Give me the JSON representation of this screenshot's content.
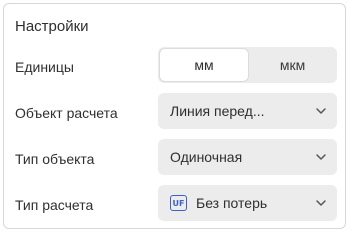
{
  "panel": {
    "title": "Настройки"
  },
  "units": {
    "label": "Единицы",
    "options": [
      "мм",
      "мкм"
    ],
    "selected": "мм"
  },
  "calc_object": {
    "label": "Объект расчета",
    "value": "Линия перед..."
  },
  "object_type": {
    "label": "Тип объекта",
    "value": "Одиночная"
  },
  "calc_type": {
    "label": "Тип расчета",
    "badge": "UF",
    "value": "Без потерь",
    "icon": "uf-badge-icon"
  },
  "colors": {
    "accent": "#3b62c9",
    "control_bg": "#ececec",
    "text": "#2f2f2f",
    "border": "#d7d7d7"
  }
}
